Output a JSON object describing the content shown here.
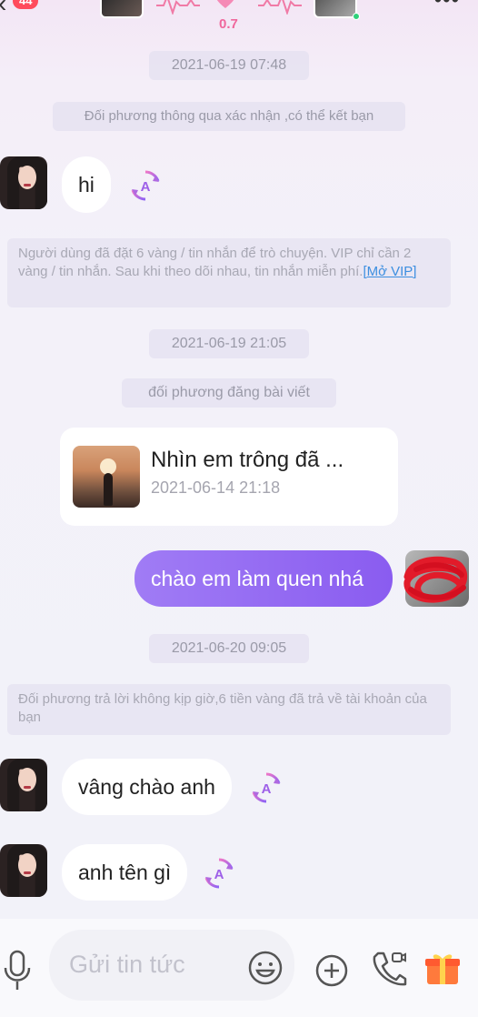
{
  "header": {
    "unread_count": "44",
    "intimacy": "0.7"
  },
  "messages": {
    "time_1": "2021-06-19 07:48",
    "system_friend": "Đối phương thông qua xác nhận ,có thể kết bạn",
    "in_hi": "hi",
    "notice_vip_text": "Người dùng đã đặt 6 vàng / tin nhắn để trò chuyện. VIP chỉ cần 2 vàng / tin nhắn. Sau khi theo dõi nhau, tin nhắn miễn phí.",
    "notice_vip_link": "[Mở VIP]",
    "time_2": "2021-06-19 21:05",
    "system_post": "đối phương đăng bài viết",
    "post_title": "Nhìn em trông đã ...",
    "post_date": "2021-06-14 21:18",
    "out_hello": "chào em làm quen nhá",
    "time_3": "2021-06-20 09:05",
    "notice_refund": "Đối phương trả lời không kịp giờ,6 tiền vàng đã trả về tài khoản của bạn",
    "in_reply": "vâng chào anh",
    "in_name": "anh tên gì"
  },
  "composer": {
    "placeholder": "Gửi tin tức"
  },
  "icons": {
    "back": "chevron-left-icon",
    "heart": "heart-icon",
    "more": "more-icon",
    "translate": "translate-icon",
    "mic": "mic-icon",
    "emoji": "emoji-icon",
    "plus": "plus-icon",
    "call": "video-call-icon",
    "gift": "gift-icon"
  },
  "colors": {
    "accent": "#8a5cf0",
    "badge": "#ff4b5c",
    "link": "#3d8fe0",
    "intimacy": "#f0679c"
  }
}
